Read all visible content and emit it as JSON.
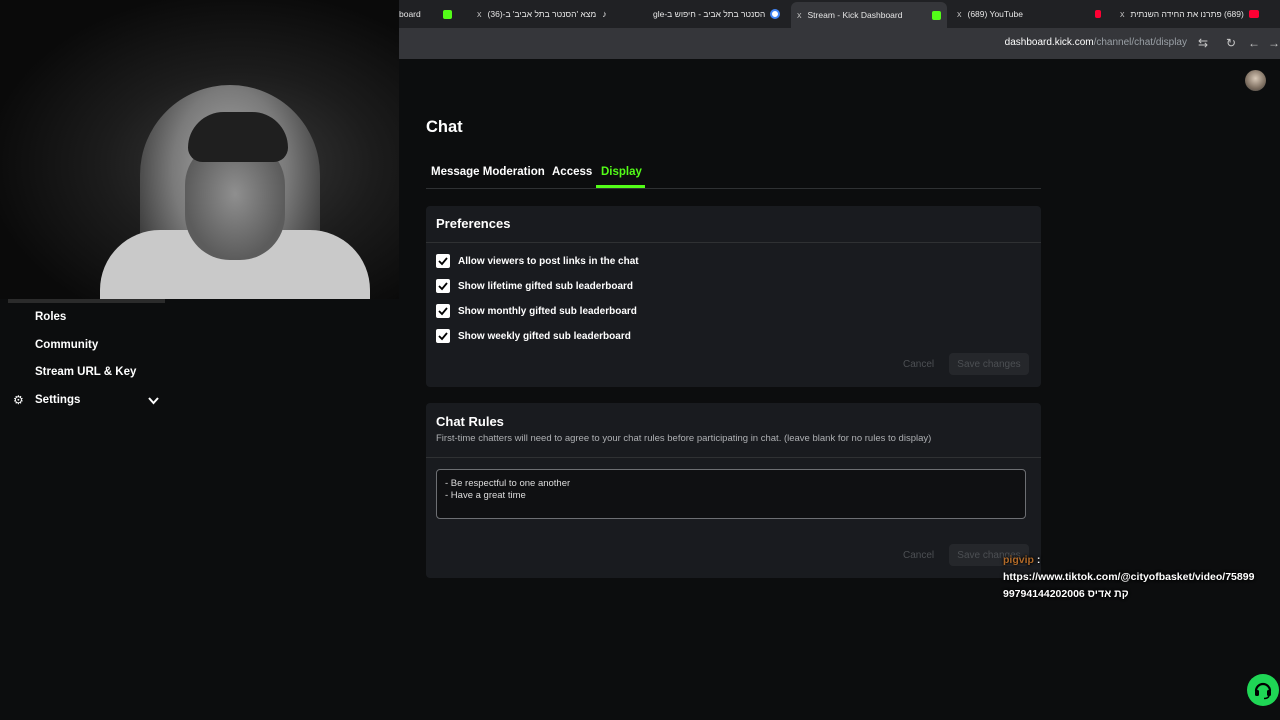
{
  "browser": {
    "tabs": [
      {
        "label": "board"
      },
      {
        "label": "מצא 'הסנטר בתל אביב' ב-(36)"
      },
      {
        "label": "הסנטר בתל אביב - חיפוש ב-gle"
      },
      {
        "label": "Stream - Kick Dashboard"
      },
      {
        "label": "(689) YouTube"
      },
      {
        "label": "(689) פתרנו את החידה השנתית"
      }
    ],
    "url_domain": "dashboard.kick.com",
    "url_path": "/channel/chat/display",
    "close_glyph": "x"
  },
  "sidebar": {
    "items": [
      {
        "label": "Roles"
      },
      {
        "label": "Community"
      },
      {
        "label": "Stream URL & Key"
      },
      {
        "label": "Settings"
      }
    ]
  },
  "page": {
    "title": "Chat",
    "tabs": [
      {
        "label": "Message Moderation"
      },
      {
        "label": "Access"
      },
      {
        "label": "Display"
      }
    ],
    "selected_tab": "Display"
  },
  "preferences": {
    "title": "Preferences",
    "options": [
      {
        "label": "Allow viewers to post links in the chat",
        "checked": true
      },
      {
        "label": "Show lifetime gifted sub leaderboard",
        "checked": true
      },
      {
        "label": "Show monthly gifted sub leaderboard",
        "checked": true
      },
      {
        "label": "Show weekly gifted sub leaderboard",
        "checked": true
      }
    ],
    "cancel_label": "Cancel",
    "save_label": "Save changes"
  },
  "chat_rules": {
    "title": "Chat Rules",
    "description": "First-time chatters will need to agree to your chat rules before participating in chat. (leave blank for no rules to display)",
    "line1": "- Be respectful to one another",
    "line2": "- Have a great time",
    "cancel_label": "Cancel",
    "save_label": "Save changes"
  },
  "overlay_chat": {
    "user": "pigvip",
    "separator": ":",
    "line1": "https://www.tiktok.com/@cityofbasket/video/75899",
    "line2": "99794144202006 קת אדיס"
  },
  "colors": {
    "accent": "#53fc18",
    "background": "#0c0d0e",
    "card": "#191b1f"
  }
}
